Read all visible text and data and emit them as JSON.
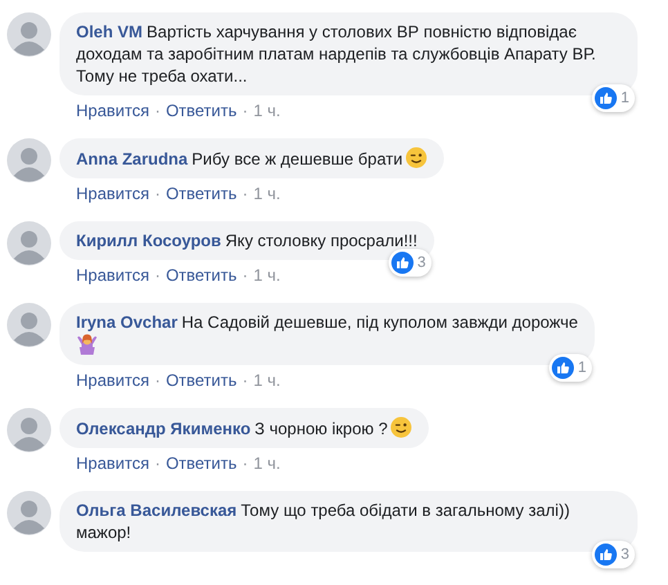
{
  "comments": [
    {
      "author": "Oleh VM",
      "text": "Вартість харчування у столових ВР повністю відповідає доходам та заробітним платам нардепів та службовців Апарату ВР. Тому не треба охати...",
      "reactions": "1",
      "actions": [
        "Нравится",
        "Ответить"
      ],
      "separator": "·",
      "time": "1 ч."
    },
    {
      "author": "Anna Zarudna",
      "text": "Рибу все ж дешевше брати",
      "emoji": {
        "kind": "wink"
      },
      "actions": [
        "Нравится",
        "Ответить"
      ],
      "separator": "·",
      "time": "1 ч."
    },
    {
      "author": "Кирилл Косоуров",
      "text": "Яку столовку просрали!!!",
      "reactions": "3",
      "actions": [
        "Нравится",
        "Ответить"
      ],
      "separator": "·",
      "time": "1 ч."
    },
    {
      "author": "Iryna Ovchar",
      "text": "На Садовій дешевше, під куполом завжди дорожче",
      "emoji": {
        "kind": "person"
      },
      "reactions": "1",
      "actions": [
        "Нравится",
        "Ответить"
      ],
      "separator": "·",
      "time": "1 ч."
    },
    {
      "author": "Олександр Якименко",
      "text": "З чорною ікрою ?",
      "emoji": {
        "kind": "wink"
      },
      "actions": [
        "Нравится",
        "Ответить"
      ],
      "separator": "·",
      "time": "1 ч."
    },
    {
      "author": "Ольга Василевская",
      "text": "Тому що треба обідати в загальному залі)) мажор!",
      "reactions": "3"
    }
  ]
}
